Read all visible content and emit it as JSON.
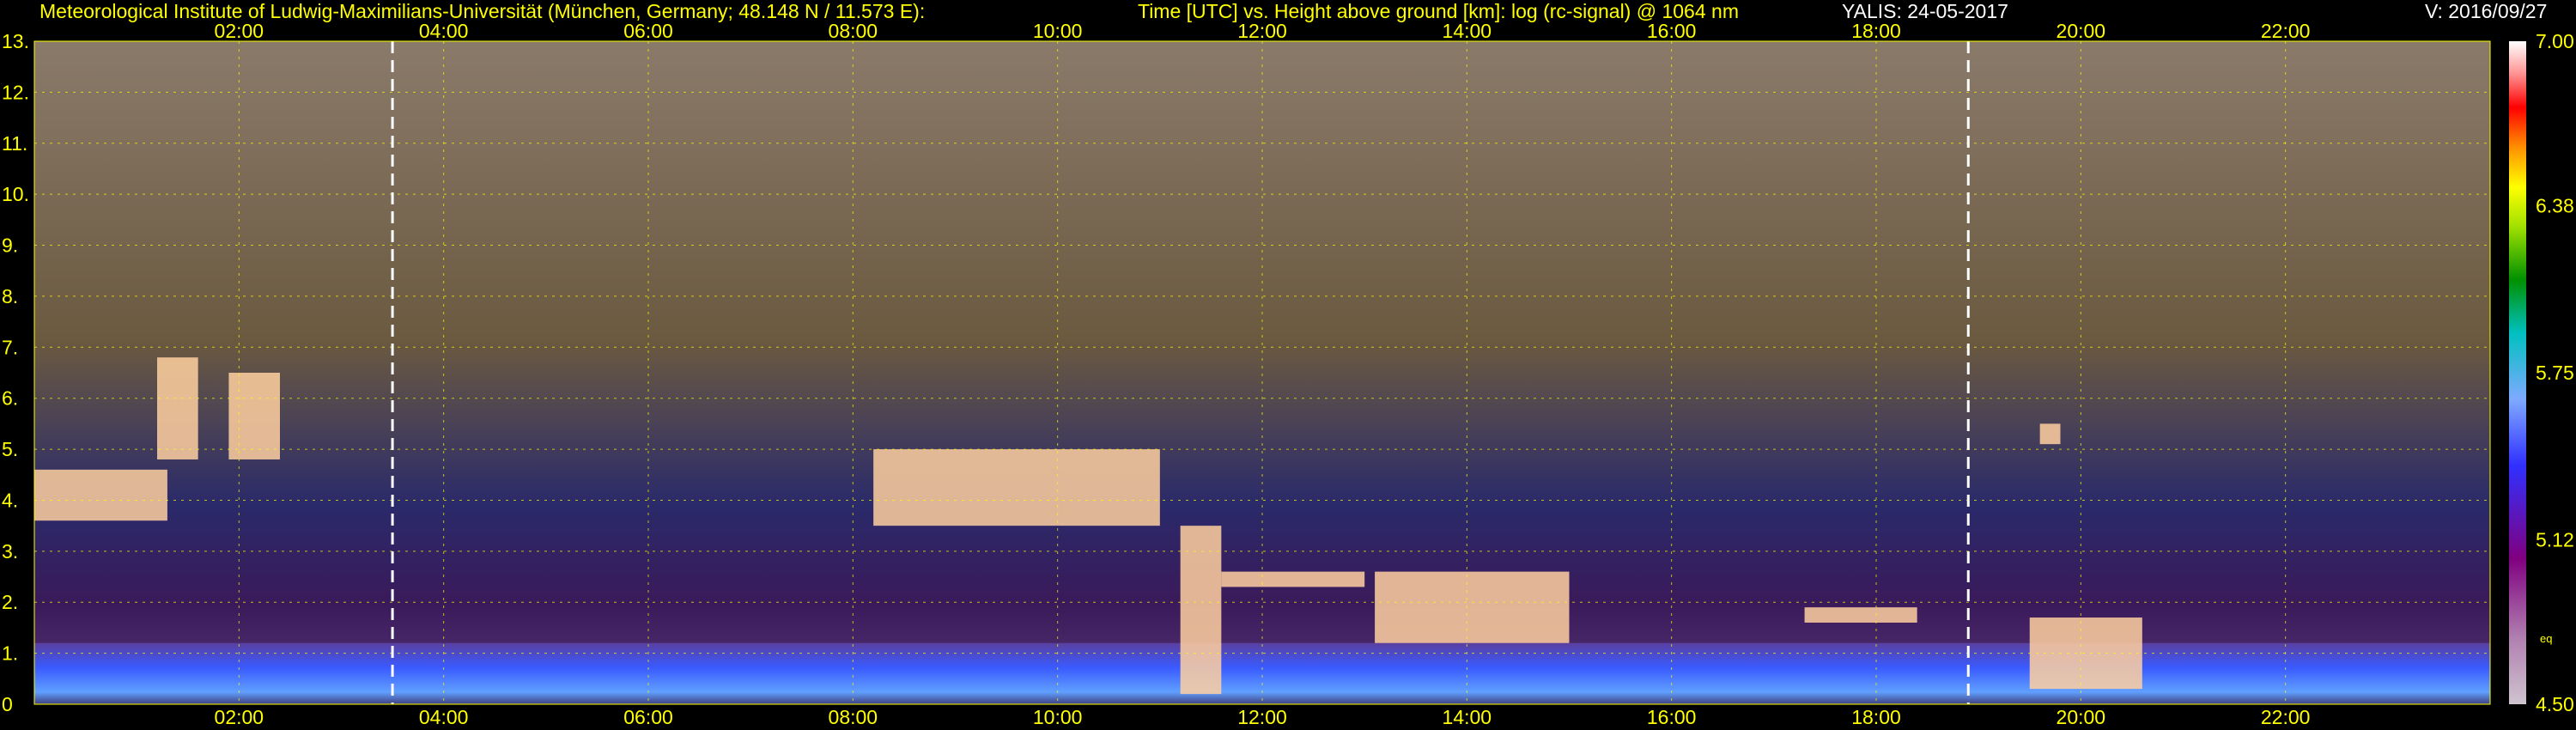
{
  "header": {
    "institute": "Meteorological Institute of Ludwig-Maximilians-Universität (München, Germany; 48.148 N / 11.573 E):",
    "axes_desc": "Time [UTC] vs. Height above ground [km]: log (rc-signal) @ 1064 nm",
    "instrument_date": "YALIS: 24-05-2017",
    "version": "V: 2016/09/27"
  },
  "chart_data": {
    "type": "heatmap",
    "title": "",
    "xlabel": "",
    "ylabel": "",
    "x_ticks": [
      "02:00",
      "04:00",
      "06:00",
      "08:00",
      "10:00",
      "12:00",
      "14:00",
      "16:00",
      "18:00",
      "20:00",
      "22:00"
    ],
    "x_tick_hours": [
      2,
      4,
      6,
      8,
      10,
      12,
      14,
      16,
      18,
      20,
      22
    ],
    "xlim_hours": [
      0,
      24
    ],
    "y_ticks": [
      "0",
      "1.",
      "2.",
      "3.",
      "4.",
      "5.",
      "6.",
      "7.",
      "8.",
      "9.",
      "10.",
      "11.",
      "12.",
      "13."
    ],
    "y_tick_values": [
      0,
      1,
      2,
      3,
      4,
      5,
      6,
      7,
      8,
      9,
      10,
      11,
      12,
      13
    ],
    "ylim_km": [
      0,
      13
    ],
    "grid": true,
    "colorbar": {
      "min": 4.5,
      "max": 7.0,
      "labels": [
        "7.00",
        "6.38",
        "5.75",
        "5.12",
        "4.50"
      ],
      "label_values": [
        7.0,
        6.38,
        5.75,
        5.12,
        4.5
      ],
      "note": "eq"
    },
    "markers_hours": [
      3.5,
      18.9
    ],
    "features": [
      {
        "name": "boundary-layer",
        "t0": 0.0,
        "t1": 24.0,
        "h0": 0.0,
        "h1": 1.2
      },
      {
        "name": "cloud-layer-1",
        "t0": 0.0,
        "t1": 1.3,
        "h0": 3.6,
        "h1": 4.6
      },
      {
        "name": "cloud-streak-1",
        "t0": 1.2,
        "t1": 1.6,
        "h0": 4.8,
        "h1": 6.8
      },
      {
        "name": "cloud-streak-2",
        "t0": 1.9,
        "t1": 2.4,
        "h0": 4.8,
        "h1": 6.5
      },
      {
        "name": "cloud-layer-2",
        "t0": 8.2,
        "t1": 11.0,
        "h0": 3.5,
        "h1": 5.0
      },
      {
        "name": "cloud-column-1",
        "t0": 11.2,
        "t1": 11.6,
        "h0": 0.2,
        "h1": 3.5
      },
      {
        "name": "cloud-layer-3",
        "t0": 11.6,
        "t1": 13.0,
        "h0": 2.3,
        "h1": 2.6
      },
      {
        "name": "cloud-layer-4",
        "t0": 13.1,
        "t1": 15.0,
        "h0": 1.2,
        "h1": 2.6
      },
      {
        "name": "cloud-layer-5",
        "t0": 17.3,
        "t1": 18.4,
        "h0": 1.6,
        "h1": 1.9
      },
      {
        "name": "cloud-column-2",
        "t0": 19.5,
        "t1": 20.6,
        "h0": 0.3,
        "h1": 1.7
      },
      {
        "name": "isolated-cloud",
        "t0": 19.6,
        "t1": 19.8,
        "h0": 5.1,
        "h1": 5.5
      }
    ]
  }
}
